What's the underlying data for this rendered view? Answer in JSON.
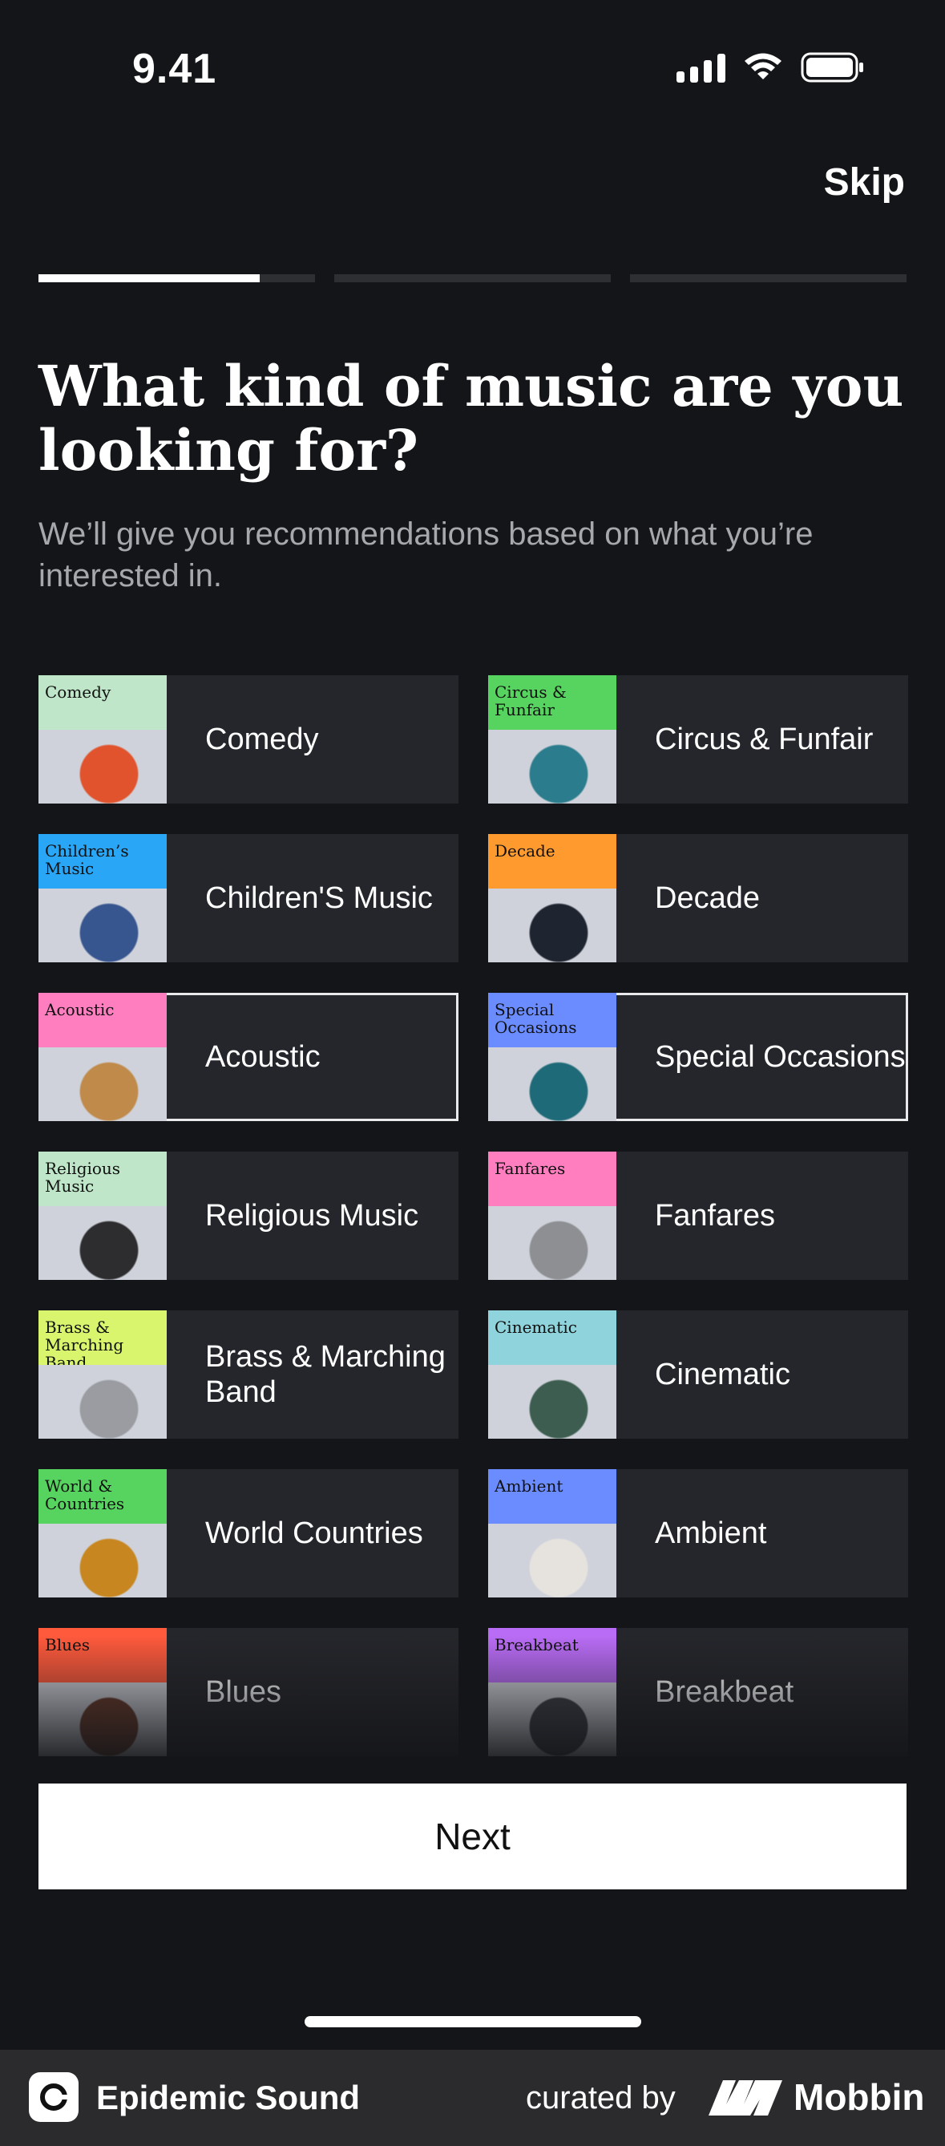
{
  "status_bar": {
    "time": "9.41",
    "icons": [
      "signal-icon",
      "wifi-icon",
      "battery-icon"
    ]
  },
  "header": {
    "skip_label": "Skip"
  },
  "progress": {
    "steps": 3,
    "current_step": 1,
    "current_step_fill": 0.8
  },
  "title": "What kind of music are you looking for?",
  "subtitle": "We’ll give you recommendations based on what you’re interested in.",
  "genres": [
    {
      "label": "Comedy",
      "thumb_tag": "Comedy",
      "band_color": "#bfe6c8",
      "art_color": "#e0532c",
      "selected": false
    },
    {
      "label": "Circus & Funfair",
      "thumb_tag": "Circus & Funfair",
      "band_color": "#57d45f",
      "art_color": "#2b7c8c",
      "selected": false
    },
    {
      "label": "Children'S Music",
      "thumb_tag": "Children’s Music",
      "band_color": "#2aa6f7",
      "art_color": "#37568f",
      "selected": false
    },
    {
      "label": "Decade",
      "thumb_tag": "Decade",
      "band_color": "#ff9a2e",
      "art_color": "#1e2430",
      "selected": false
    },
    {
      "label": "Acoustic",
      "thumb_tag": "Acoustic",
      "band_color": "#ff7ec0",
      "art_color": "#c08a4a",
      "selected": true
    },
    {
      "label": "Special Occasions",
      "thumb_tag": "Special Occasions",
      "band_color": "#6b8cff",
      "art_color": "#1f6a78",
      "selected": true
    },
    {
      "label": "Religious Music",
      "thumb_tag": "Religious Music",
      "band_color": "#bfe6c8",
      "art_color": "#2d2d30",
      "selected": false
    },
    {
      "label": "Fanfares",
      "thumb_tag": "Fanfares",
      "band_color": "#ff7ec0",
      "art_color": "#8d8f93",
      "selected": false
    },
    {
      "label": "Brass & Marching Band",
      "thumb_tag": "Brass & Marching Band",
      "band_color": "#d9f56e",
      "art_color": "#9a9ca2",
      "selected": false
    },
    {
      "label": "Cinematic",
      "thumb_tag": "Cinematic",
      "band_color": "#8fd3dc",
      "art_color": "#3c5d4f",
      "selected": false
    },
    {
      "label": "World Countries",
      "thumb_tag": "World & Countries",
      "band_color": "#57d45f",
      "art_color": "#c7861f",
      "selected": false
    },
    {
      "label": "Ambient",
      "thumb_tag": "Ambient",
      "band_color": "#6b8cff",
      "art_color": "#e6e3df",
      "selected": false
    },
    {
      "label": "Blues",
      "thumb_tag": "Blues",
      "band_color": "#ff5a3c",
      "art_color": "#6b3a2a",
      "selected": false
    },
    {
      "label": "Breakbeat",
      "thumb_tag": "Breakbeat",
      "band_color": "#b96cf5",
      "art_color": "#3c3f48",
      "selected": false
    }
  ],
  "next_label": "Next",
  "footer": {
    "brand": "Epidemic Sound",
    "curated_by": "curated by",
    "curator": "Mobbin"
  }
}
